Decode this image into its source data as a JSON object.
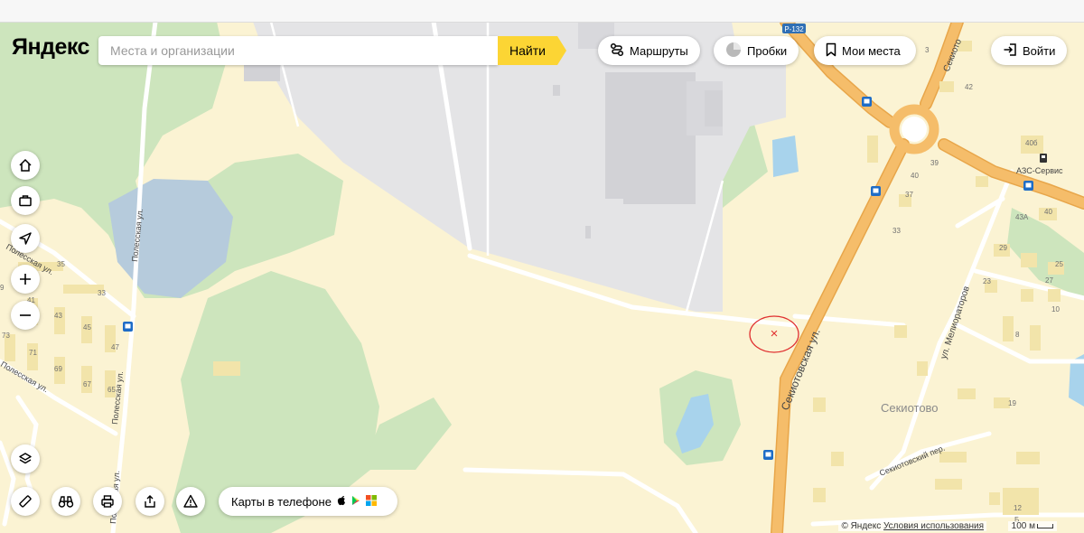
{
  "header": {
    "logo_text": "Яндекс",
    "search_placeholder": "Места и организации",
    "search_button": "Найти",
    "routes_label": "Маршруты",
    "traffic_label": "Пробки",
    "my_places_label": "Мои места",
    "login_label": "Войти"
  },
  "controls": {
    "phone_promo_label": "Карты в телефоне"
  },
  "footer": {
    "copyright": "© Яндекс",
    "terms_link": "Условия использования",
    "scale_label": "100 м"
  },
  "map": {
    "road_labels": {
      "polesskaya_1": "Полесская ул.",
      "polesskaya_2": "Полесская ул.",
      "polesskaya_3": "Полесская ул.",
      "polesskaya_4": "Полесская ул.",
      "sekiotovskaya": "Секиотовская ул.",
      "meliorators": "ул. Мелиораторов",
      "sekiotovo_road": "Секиото",
      "sekiotovsky_per": "Секиотовский пер.",
      "route_shield": "Р-132"
    },
    "place_labels": {
      "village": "Секиотово",
      "gas_station": "АЗС-Сервис"
    },
    "house_numbers": [
      "35",
      "33",
      "41",
      "43",
      "45",
      "47",
      "9",
      "73",
      "71",
      "69",
      "67",
      "65",
      "3",
      "42",
      "40б",
      "39",
      "40",
      "37",
      "33",
      "43А",
      "40",
      "29",
      "25",
      "27",
      "23",
      "10",
      "8",
      "19",
      "12",
      "Б"
    ],
    "marker_symbol": "×"
  },
  "colors": {
    "background": "#fbf3d3",
    "main_road": "#f5bd6a",
    "forest": "#cde5bd",
    "water": "#a8d3ec",
    "industrial": "#e4e4e6",
    "accent_yellow": "#fcd534",
    "annotation_red": "#e03030"
  }
}
